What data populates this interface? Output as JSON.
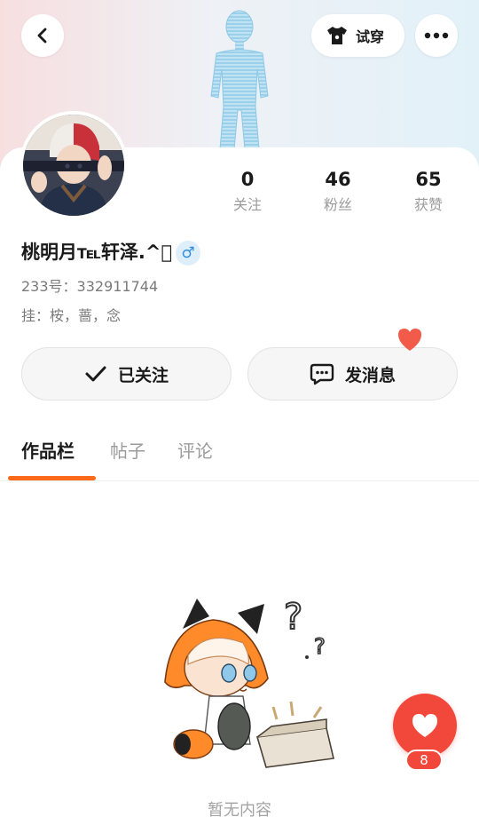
{
  "header": {
    "tryon_label": "试穿",
    "icons": [
      "back-icon",
      "tshirt-icon",
      "more-icon"
    ]
  },
  "profile": {
    "username": "桃明月℡轩泽.^\u0000",
    "gender_symbol": "♂",
    "id_line": "233号：332911744",
    "pendant_line": "挂：桉，蔷，念"
  },
  "stats": [
    {
      "value": "0",
      "label": "关注"
    },
    {
      "value": "46",
      "label": "粉丝"
    },
    {
      "value": "65",
      "label": "获赞"
    }
  ],
  "actions": {
    "follow_label": "已关注",
    "message_label": "发消息"
  },
  "tabs": [
    {
      "label": "作品栏",
      "active": true
    },
    {
      "label": "帖子",
      "active": false
    },
    {
      "label": "评论",
      "active": false
    }
  ],
  "empty_state": {
    "text": "暂无内容"
  },
  "like_fab": {
    "count": "8"
  },
  "colors": {
    "accent": "#ff6a1a",
    "like_red": "#f2483b",
    "gender_blue": "#2f8ee0",
    "muted_text": "#9b9b9b"
  }
}
